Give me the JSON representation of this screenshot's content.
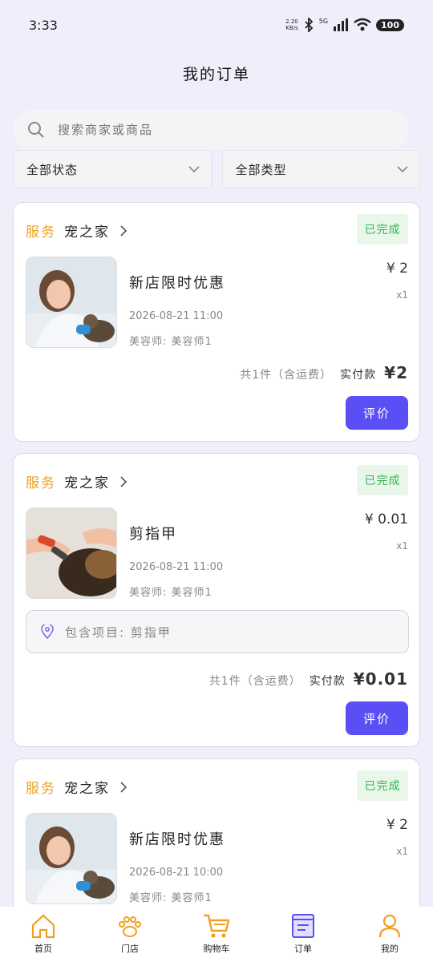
{
  "status_bar": {
    "time": "3:33",
    "speed_value": "2.20",
    "speed_unit": "KB/s",
    "network": "5G",
    "battery": "100"
  },
  "header": {
    "title": "我的订单"
  },
  "search": {
    "placeholder": "搜索商家或商品"
  },
  "filters": {
    "status": "全部状态",
    "type": "全部类型"
  },
  "orders": [
    {
      "tag": "服务",
      "shop": "宠之家",
      "status": "已完成",
      "name": "新店限时优惠",
      "time": "2026-08-21 11:00",
      "staff": "美容师: 美容师1",
      "price": "¥ 2",
      "qty": "x1",
      "summary_count": "共1件（含运费）",
      "summary_paid": "实付款",
      "summary_total": "¥2",
      "action": "评价"
    },
    {
      "tag": "服务",
      "shop": "宠之家",
      "status": "已完成",
      "name": "剪指甲",
      "time": "2026-08-21 11:00",
      "staff": "美容师: 美容师1",
      "price": "¥ 0.01",
      "qty": "x1",
      "includes": "包含项目: 剪指甲",
      "summary_count": "共1件（含运费）",
      "summary_paid": "实付款",
      "summary_total": "¥0.01",
      "action": "评价"
    },
    {
      "tag": "服务",
      "shop": "宠之家",
      "status": "已完成",
      "name": "新店限时优惠",
      "time": "2026-08-21 10:00",
      "staff": "美容师: 美容师1",
      "price": "¥ 2",
      "qty": "x1"
    }
  ],
  "nav": [
    {
      "label": "首页",
      "icon": "home-icon",
      "color": "#f0a020"
    },
    {
      "label": "门店",
      "icon": "paw-icon",
      "color": "#f0a020"
    },
    {
      "label": "购物车",
      "icon": "cart-icon",
      "color": "#f0a020"
    },
    {
      "label": "订单",
      "icon": "order-icon",
      "color": "#5a4ff5"
    },
    {
      "label": "我的",
      "icon": "user-icon",
      "color": "#f0a020"
    }
  ],
  "colors": {
    "accent": "#5a4ff5",
    "service": "#f0a020",
    "done": "#37b24d",
    "background": "#efeefb"
  }
}
